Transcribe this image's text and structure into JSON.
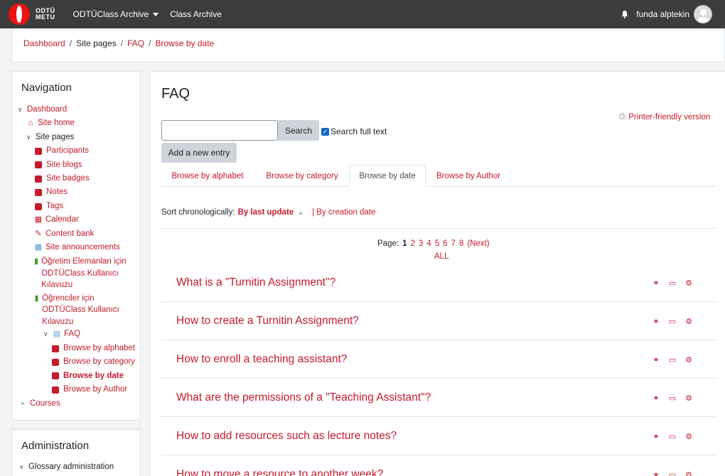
{
  "topbar": {
    "logo_line1": "ODTÜ",
    "logo_line2": "METU",
    "menu_archive": "ODTÜClass Archive",
    "menu_class_archive": "Class Archive",
    "user_name": "funda alptekin"
  },
  "breadcrumb": {
    "items": [
      "Dashboard",
      "Site pages",
      "FAQ",
      "Browse by date"
    ]
  },
  "navigation": {
    "title": "Navigation",
    "dashboard": "Dashboard",
    "site_home": "Site home",
    "site_pages": "Site pages",
    "participants": "Participants",
    "site_blogs": "Site blogs",
    "site_badges": "Site badges",
    "notes": "Notes",
    "tags": "Tags",
    "calendar": "Calendar",
    "content_bank": "Content bank",
    "site_announcements": "Site announcements",
    "guide_staff": "Öğretim Elemanları için ODTÜClass Kullanıcı Kılavuzu",
    "guide_students": "Öğrenciler için ODTÜClass Kullanıcı Kılavuzu",
    "faq": "FAQ",
    "browse_alphabet": "Browse by alphabet",
    "browse_category": "Browse by category",
    "browse_date": "Browse by date",
    "browse_author": "Browse by Author",
    "courses": "Courses"
  },
  "administration": {
    "title": "Administration",
    "glossary_admin": "Glossary administration"
  },
  "main": {
    "title": "FAQ",
    "printer_friendly": "Printer-friendly version",
    "search_button": "Search",
    "search_value": "",
    "search_full_text": "Search full text",
    "add_entry": "Add a new entry",
    "tabs": [
      "Browse by alphabet",
      "Browse by category",
      "Browse by date",
      "Browse by Author"
    ],
    "active_tab": "Browse by date",
    "sort_label": "Sort chronologically:",
    "sort_last_update": "By last update",
    "sort_creation": "| By creation date",
    "page_label": "Page:",
    "current_page": "1",
    "pages": [
      "2",
      "3",
      "4",
      "5",
      "6",
      "7",
      "8"
    ],
    "next": "(Next)",
    "all": "ALL",
    "entries": [
      "What is a \"Turnitin Assignment\"?",
      "How to create a Turnitin Assignment?",
      "How to enroll a teaching assistant?",
      "What are the permissions of a \"Teaching Assistant\"?",
      "How to add resources such as lecture notes?",
      "How to move a resource to another week?"
    ]
  },
  "colors": {
    "accent": "#c51a2b",
    "topbar": "#3c3c3c"
  }
}
